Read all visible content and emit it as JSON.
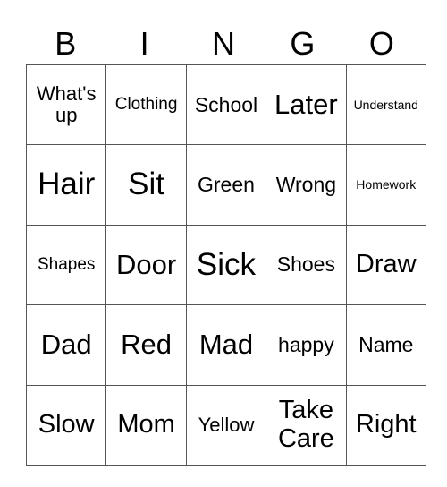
{
  "card": {
    "header": [
      "B",
      "I",
      "N",
      "G",
      "O"
    ],
    "rows": [
      [
        "What's up",
        "Clothing",
        "School",
        "Later",
        "Understand"
      ],
      [
        "Hair",
        "Sit",
        "Green",
        "Wrong",
        "Homework"
      ],
      [
        "Shapes",
        "Door",
        "Sick",
        "Shoes",
        "Draw"
      ],
      [
        "Dad",
        "Red",
        "Mad",
        "happy",
        "Name"
      ],
      [
        "Slow",
        "Mom",
        "Yellow",
        "Take Care",
        "Right"
      ]
    ]
  }
}
